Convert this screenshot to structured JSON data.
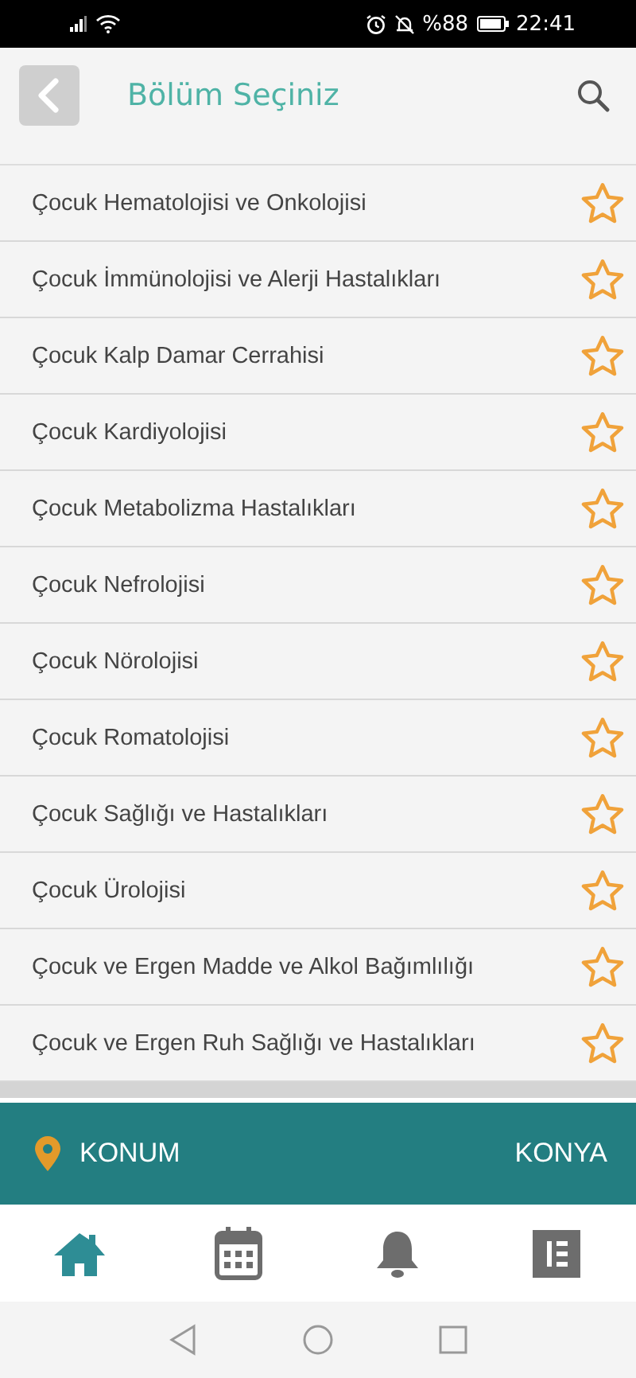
{
  "status_bar": {
    "battery": "%88",
    "time": "22:41"
  },
  "header": {
    "title": "Bölüm Seçiniz"
  },
  "departments": [
    {
      "name": "Çocuk Hematolojisi ve Onkolojisi",
      "favorite": false
    },
    {
      "name": "Çocuk İmmünolojisi ve Alerji Hastalıkları",
      "favorite": false
    },
    {
      "name": "Çocuk Kalp Damar Cerrahisi",
      "favorite": false
    },
    {
      "name": "Çocuk Kardiyolojisi",
      "favorite": false
    },
    {
      "name": "Çocuk Metabolizma Hastalıkları",
      "favorite": false
    },
    {
      "name": "Çocuk Nefrolojisi",
      "favorite": false
    },
    {
      "name": "Çocuk Nörolojisi",
      "favorite": false
    },
    {
      "name": "Çocuk Romatolojisi",
      "favorite": false
    },
    {
      "name": "Çocuk Sağlığı ve Hastalıkları",
      "favorite": false
    },
    {
      "name": "Çocuk Ürolojisi",
      "favorite": false
    },
    {
      "name": "Çocuk ve Ergen Madde ve Alkol Bağımlılığı",
      "favorite": false
    },
    {
      "name": "Çocuk ve Ergen Ruh Sağlığı ve Hastalıkları",
      "favorite": false
    }
  ],
  "location_bar": {
    "label": "KONUM",
    "value": "KONYA"
  },
  "bottom_nav": [
    {
      "kind": "home",
      "selected": true
    },
    {
      "kind": "calendar",
      "selected": false
    },
    {
      "kind": "bell",
      "selected": false
    },
    {
      "kind": "list",
      "selected": false
    }
  ]
}
